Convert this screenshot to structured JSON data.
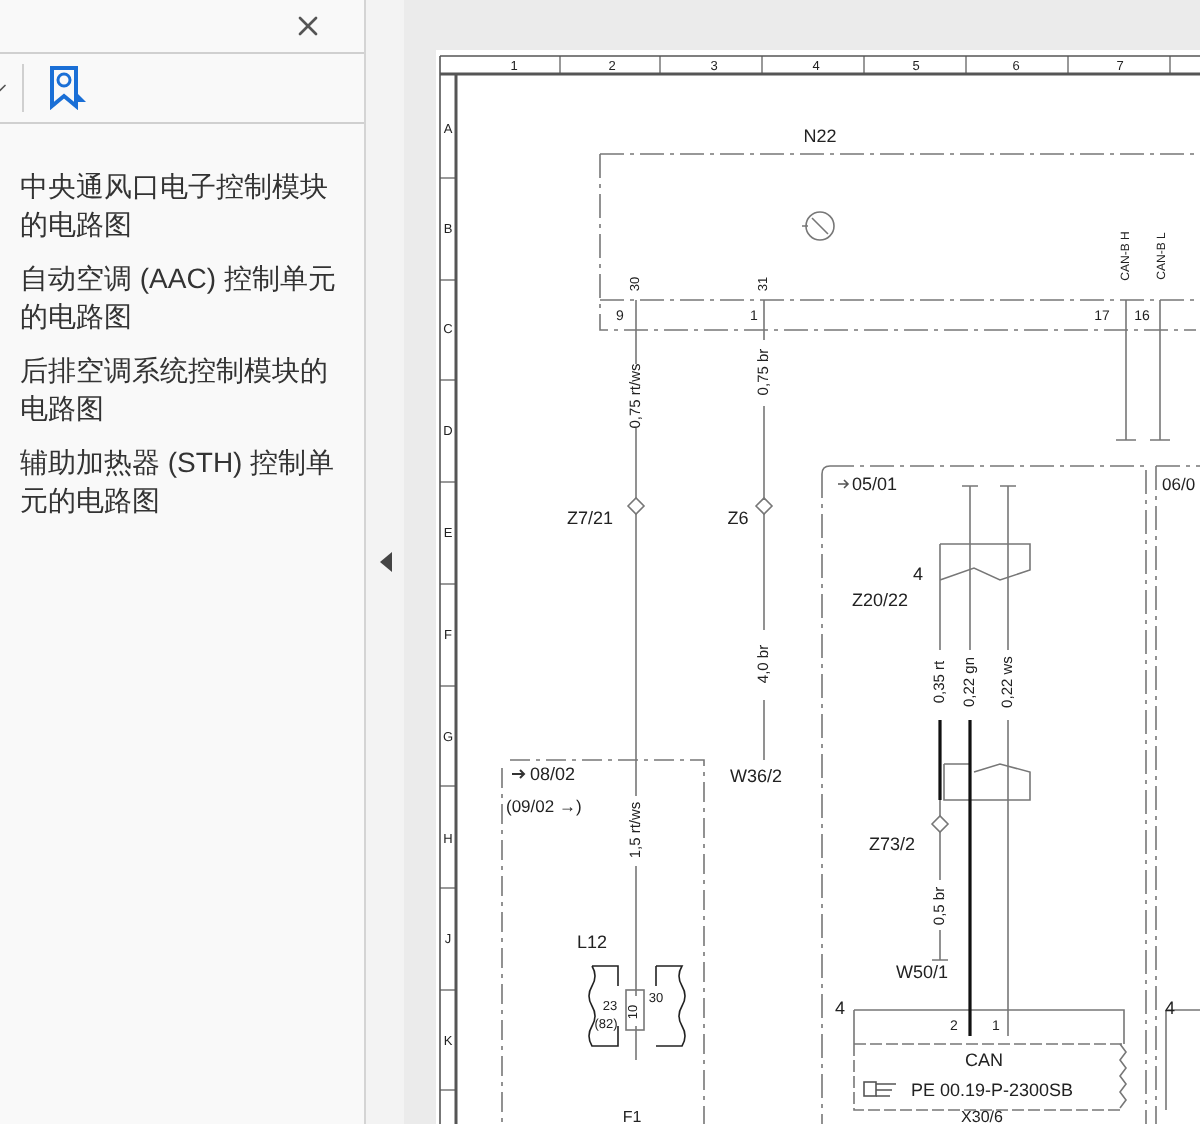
{
  "sidebar": {
    "items": [
      {
        "label": "中央通风口电子控制模块的电路图"
      },
      {
        "label": "自动空调 (AAC) 控制单元的电路图"
      },
      {
        "label": "后排空调系统控制模块的电路图"
      },
      {
        "label": "辅助加热器 (STH) 控制单元的电路图"
      }
    ]
  },
  "diagram": {
    "column_numbers": [
      "1",
      "2",
      "3",
      "4",
      "5",
      "6",
      "7"
    ],
    "row_letters": [
      "A",
      "B",
      "C",
      "D",
      "E",
      "F",
      "G",
      "H",
      "J",
      "K"
    ],
    "labels": [
      "N22",
      "30",
      "31",
      "CAN-B H",
      "CAN-B L",
      "9",
      "1",
      "17",
      "16",
      "0,75 rt/ws",
      "0,75 br",
      "Z7/21",
      "Z6",
      "05/01",
      "06/0",
      "4",
      "Z20/22",
      "4,0 br",
      "0,35 rt",
      "0,22 gn",
      "0,22 ws",
      "W36/2",
      "08/02",
      "(09/02 →)",
      "1,5 rt/ws",
      "Z73/2",
      "0,5 br",
      "L12",
      "W50/1",
      "23",
      "(82)",
      "10",
      "30",
      "4",
      "2",
      "1",
      "4",
      "CAN",
      "PE 00.19-P-2300SB",
      "X30/6",
      "F1"
    ]
  }
}
